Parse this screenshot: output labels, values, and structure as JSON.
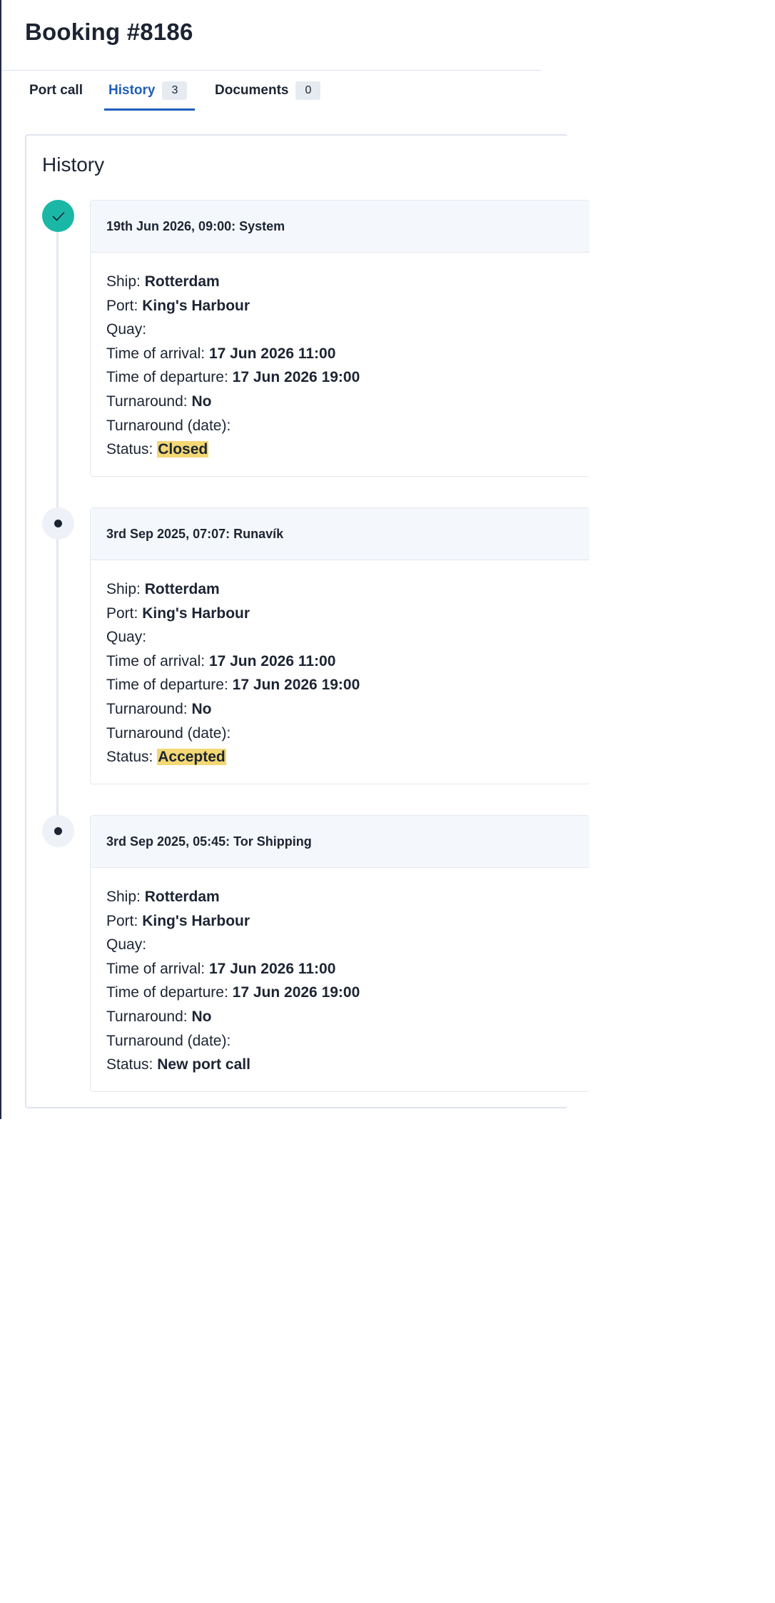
{
  "page": {
    "title": "Booking #8186"
  },
  "tabs": [
    {
      "label": "Port call",
      "count": null
    },
    {
      "label": "History",
      "count": "3"
    },
    {
      "label": "Documents",
      "count": "0"
    }
  ],
  "history": {
    "title": "History",
    "labels": {
      "ship": "Ship:",
      "port": "Port:",
      "quay": "Quay:",
      "arrival": "Time of arrival:",
      "departure": "Time of departure:",
      "turnaround": "Turnaround:",
      "turnaround_date": "Turnaround (date):",
      "status": "Status:"
    },
    "entries": [
      {
        "header": "19th Jun 2026, 09:00: System",
        "marker": "check-icon",
        "ship": "Rotterdam",
        "port": "King's Harbour",
        "quay": "",
        "arrival": "17 Jun 2026 11:00",
        "departure": "17 Jun 2026 19:00",
        "turnaround": "No",
        "turnaround_date": "",
        "status": "Closed",
        "status_highlighted": true
      },
      {
        "header": "3rd Sep 2025, 07:07: Runavík",
        "marker": "dot-icon",
        "ship": "Rotterdam",
        "port": "King's Harbour",
        "quay": "",
        "arrival": "17 Jun 2026 11:00",
        "departure": "17 Jun 2026 19:00",
        "turnaround": "No",
        "turnaround_date": "",
        "status": "Accepted",
        "status_highlighted": true
      },
      {
        "header": "3rd Sep 2025, 05:45: Tor Shipping",
        "marker": "dot-icon",
        "ship": "Rotterdam",
        "port": "King's Harbour",
        "quay": "",
        "arrival": "17 Jun 2026 11:00",
        "departure": "17 Jun 2026 19:00",
        "turnaround": "No",
        "turnaround_date": "",
        "status": "New port call",
        "status_highlighted": false
      }
    ]
  },
  "colors": {
    "accent": "#1f5fb8",
    "success": "#1bb7a6",
    "highlight": "#f3d873"
  }
}
